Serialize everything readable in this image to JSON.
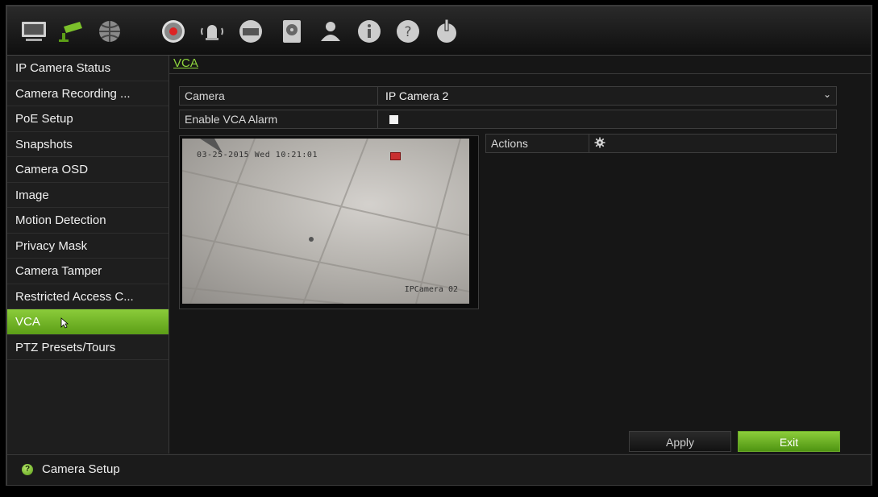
{
  "toolbar": {
    "icons": [
      {
        "name": "display-icon",
        "active": false
      },
      {
        "name": "camera-icon",
        "active": true
      },
      {
        "name": "network-icon",
        "active": false
      },
      {
        "name": "record-icon",
        "active": false
      },
      {
        "name": "alarm-icon",
        "active": false
      },
      {
        "name": "device-icon",
        "active": false
      },
      {
        "name": "hdd-icon",
        "active": false
      },
      {
        "name": "user-icon",
        "active": false
      },
      {
        "name": "info-icon",
        "active": false
      },
      {
        "name": "help-icon",
        "active": false
      },
      {
        "name": "power-icon",
        "active": false
      }
    ],
    "accent": "#8bcc3a"
  },
  "sidebar": {
    "items": [
      {
        "label": "IP Camera Status"
      },
      {
        "label": "Camera Recording ..."
      },
      {
        "label": "PoE Setup"
      },
      {
        "label": "Snapshots"
      },
      {
        "label": "Camera OSD"
      },
      {
        "label": "Image"
      },
      {
        "label": "Motion Detection"
      },
      {
        "label": "Privacy Mask"
      },
      {
        "label": "Camera Tamper"
      },
      {
        "label": "Restricted Access C..."
      },
      {
        "label": "VCA",
        "active": true
      },
      {
        "label": "PTZ Presets/Tours"
      }
    ]
  },
  "main": {
    "breadcrumb": "VCA",
    "camera_label": "Camera",
    "camera_value": "IP Camera 2",
    "enable_label": "Enable VCA Alarm",
    "enable_checked": false,
    "video": {
      "timestamp": "03-25-2015 Wed 10:21:01",
      "camera_name": "IPCamera 02"
    },
    "actions_label": "Actions",
    "apply_label": "Apply",
    "exit_label": "Exit"
  },
  "status": {
    "text": "Camera Setup"
  }
}
